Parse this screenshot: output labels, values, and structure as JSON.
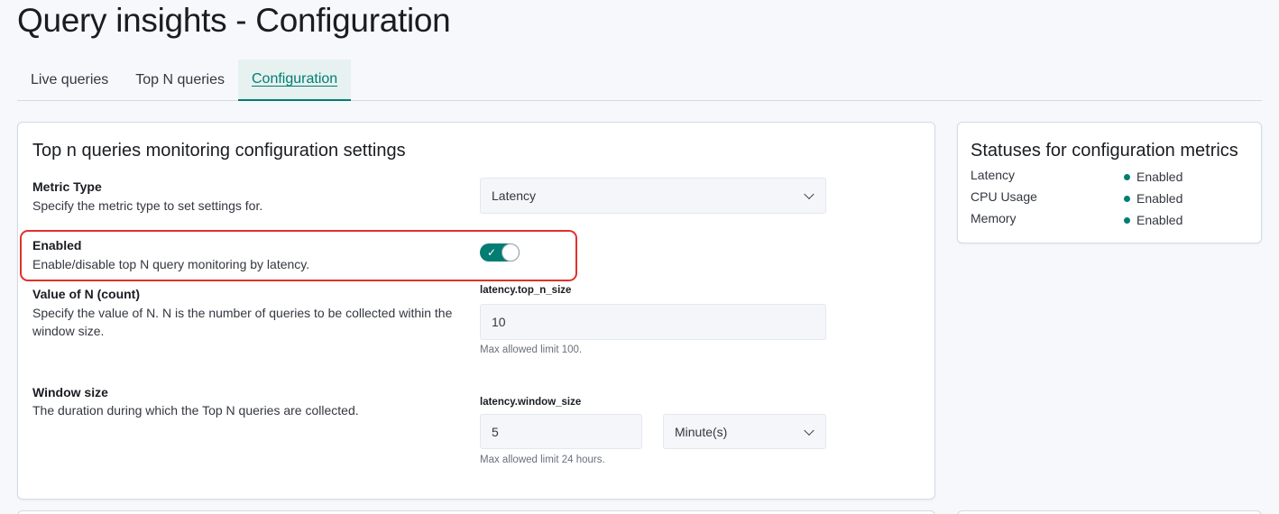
{
  "page": {
    "title": "Query insights - Configuration"
  },
  "tabs": [
    {
      "label": "Live queries"
    },
    {
      "label": "Top N queries"
    },
    {
      "label": "Configuration"
    }
  ],
  "config_panel": {
    "heading": "Top n queries monitoring configuration settings",
    "metric_type": {
      "title": "Metric Type",
      "description": "Specify the metric type to set settings for.",
      "selected": "Latency"
    },
    "enabled": {
      "title": "Enabled",
      "description": "Enable/disable top N query monitoring by latency.",
      "value": true
    },
    "top_n": {
      "title": "Value of N (count)",
      "description": "Specify the value of N. N is the number of queries to be collected within the window size.",
      "control_label": "latency.top_n_size",
      "value": "10",
      "help": "Max allowed limit 100."
    },
    "window_size": {
      "title": "Window size",
      "description": "The duration during which the Top N queries are collected.",
      "control_label": "latency.window_size",
      "value": "5",
      "unit": "Minute(s)",
      "help": "Max allowed limit 24 hours."
    }
  },
  "status_panel": {
    "heading": "Statuses for configuration metrics",
    "rows": [
      {
        "metric": "Latency",
        "status": "Enabled"
      },
      {
        "metric": "CPU Usage",
        "status": "Enabled"
      },
      {
        "metric": "Memory",
        "status": "Enabled"
      }
    ]
  },
  "colors": {
    "accent": "#017d73",
    "highlight": "#e0302a"
  }
}
